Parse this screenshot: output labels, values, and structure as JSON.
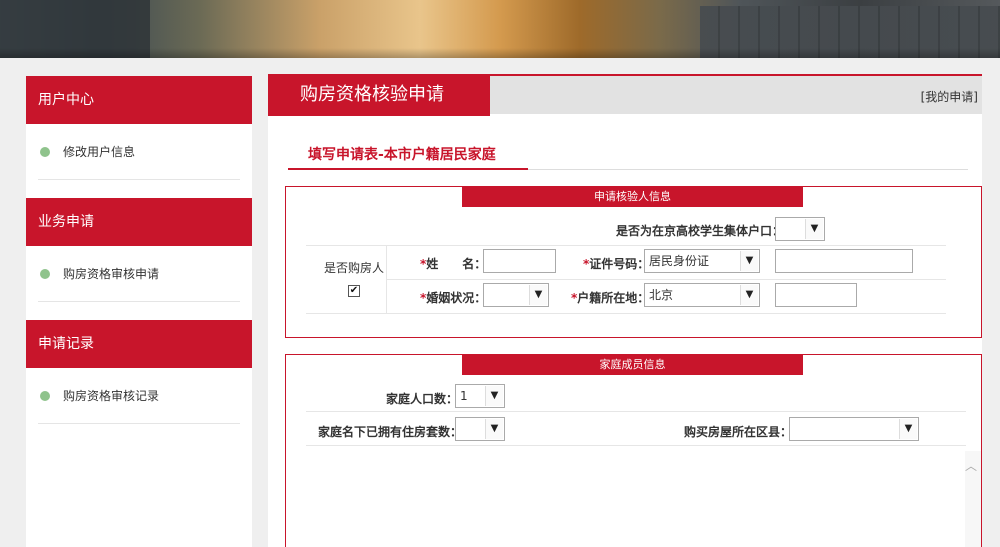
{
  "sidebar": {
    "sections": [
      {
        "title": "用户中心",
        "items": [
          "修改用户信息"
        ]
      },
      {
        "title": "业务申请",
        "items": [
          "购房资格审核申请"
        ]
      },
      {
        "title": "申请记录",
        "items": [
          "购房资格审核记录"
        ]
      }
    ]
  },
  "main": {
    "title": "购房资格核验申请",
    "my_apply": "[我的申请]",
    "form_title": "填写申请表-本市户籍居民家庭"
  },
  "applicant": {
    "section_title": "申请核验人信息",
    "student_collective_label": "是否为在京高校学生集体户口：",
    "student_collective_value": "",
    "is_buyer_label": "是否购房人",
    "is_buyer_checked": "✔",
    "name_label": "姓　　名：",
    "name_value": "",
    "id_type_label": "证件号码：",
    "id_type_value": "居民身份证",
    "id_number_value": "",
    "marital_label": "婚姻状况：",
    "marital_value": "",
    "hukou_label": "户籍所在地：",
    "hukou_value": "北京",
    "hukou_extra_value": ""
  },
  "family": {
    "section_title": "家庭成员信息",
    "population_label": "家庭人口数：",
    "population_value": "1",
    "houses_owned_label": "家庭名下已拥有住房套数：",
    "houses_owned_value": "",
    "district_label": "购买房屋所在区县：",
    "district_value": ""
  },
  "colors": {
    "accent": "#c8152b",
    "dot": "#8fc38c"
  }
}
